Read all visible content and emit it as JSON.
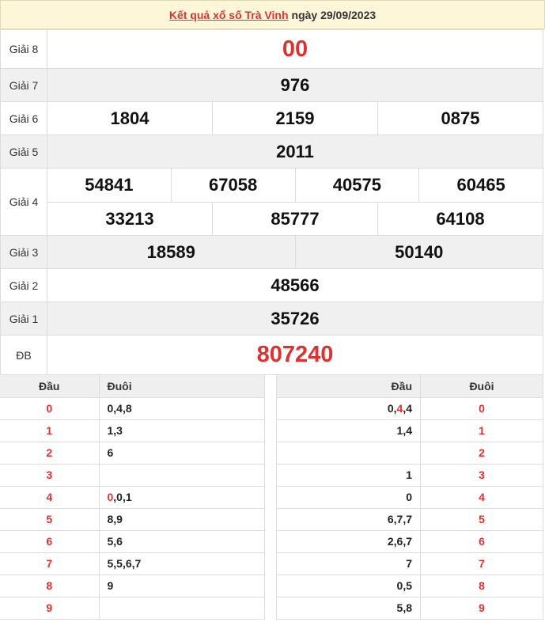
{
  "header": {
    "title_link": "Kết quả xổ số Trà Vinh",
    "date_text": "ngày 29/09/2023"
  },
  "prizes": {
    "g8": {
      "label": "Giải 8",
      "values": [
        "00"
      ]
    },
    "g7": {
      "label": "Giải 7",
      "values": [
        "976"
      ]
    },
    "g6": {
      "label": "Giải 6",
      "values": [
        "1804",
        "2159",
        "0875"
      ]
    },
    "g5": {
      "label": "Giải 5",
      "values": [
        "2011"
      ]
    },
    "g4": {
      "label": "Giải 4",
      "row1": [
        "54841",
        "67058",
        "40575",
        "60465"
      ],
      "row2": [
        "33213",
        "85777",
        "64108"
      ]
    },
    "g3": {
      "label": "Giải 3",
      "values": [
        "18589",
        "50140"
      ]
    },
    "g2": {
      "label": "Giải 2",
      "values": [
        "48566"
      ]
    },
    "g1": {
      "label": "Giải 1",
      "values": [
        "35726"
      ]
    },
    "db": {
      "label": "ĐB",
      "values": [
        "807240"
      ]
    }
  },
  "loto_left": {
    "col_head": "Đầu",
    "col_tail": "Đuôi",
    "rows": [
      {
        "head": "0",
        "tail_pre": "",
        "tail_hl": "",
        "tail": "0,4,8"
      },
      {
        "head": "1",
        "tail_pre": "",
        "tail_hl": "",
        "tail": "1,3"
      },
      {
        "head": "2",
        "tail_pre": "",
        "tail_hl": "",
        "tail": "6"
      },
      {
        "head": "3",
        "tail_pre": "",
        "tail_hl": "",
        "tail": ""
      },
      {
        "head": "4",
        "tail_pre": "",
        "tail_hl": "0",
        "tail": ",0,1"
      },
      {
        "head": "5",
        "tail_pre": "",
        "tail_hl": "",
        "tail": "8,9"
      },
      {
        "head": "6",
        "tail_pre": "",
        "tail_hl": "",
        "tail": "5,6"
      },
      {
        "head": "7",
        "tail_pre": "",
        "tail_hl": "",
        "tail": "5,5,6,7"
      },
      {
        "head": "8",
        "tail_pre": "",
        "tail_hl": "",
        "tail": "9"
      },
      {
        "head": "9",
        "tail_pre": "",
        "tail_hl": "",
        "tail": ""
      }
    ]
  },
  "loto_right": {
    "col_head": "Đầu",
    "col_tail": "Đuôi",
    "rows": [
      {
        "pre": "0,",
        "hl": "4",
        "post": ",4",
        "tail": "0"
      },
      {
        "pre": "1,4",
        "hl": "",
        "post": "",
        "tail": "1"
      },
      {
        "pre": "",
        "hl": "",
        "post": "",
        "tail": "2"
      },
      {
        "pre": "1",
        "hl": "",
        "post": "",
        "tail": "3"
      },
      {
        "pre": "0",
        "hl": "",
        "post": "",
        "tail": "4"
      },
      {
        "pre": "6,7,7",
        "hl": "",
        "post": "",
        "tail": "5"
      },
      {
        "pre": "2,6,7",
        "hl": "",
        "post": "",
        "tail": "6"
      },
      {
        "pre": "7",
        "hl": "",
        "post": "",
        "tail": "7"
      },
      {
        "pre": "0,5",
        "hl": "",
        "post": "",
        "tail": "8"
      },
      {
        "pre": "5,8",
        "hl": "",
        "post": "",
        "tail": "9"
      }
    ]
  },
  "colors": {
    "accent_red": "#e03131",
    "header_bg": "#fdf6d8",
    "row_gray": "#f0f0f0"
  }
}
